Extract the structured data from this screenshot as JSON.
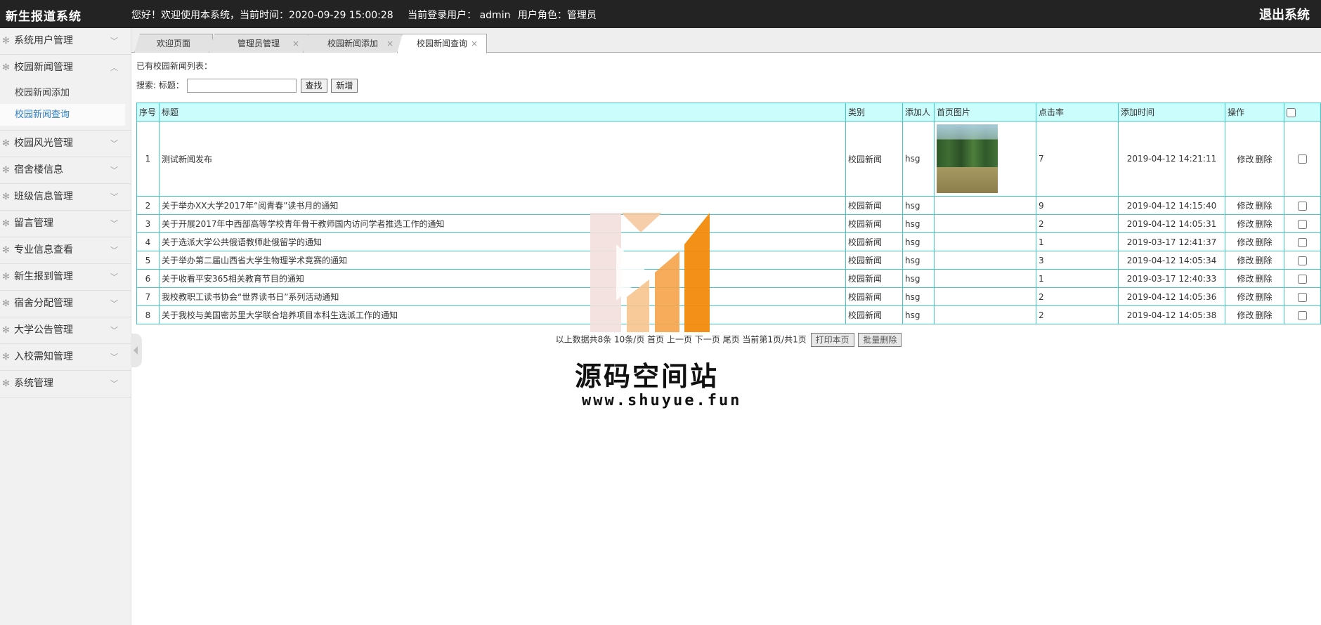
{
  "header": {
    "brand": "新生报道系统",
    "welcome": "您好！欢迎使用本系统，当前时间：2020-09-29 15:00:28",
    "current_user": "当前登录用户： admin",
    "user_role": "用户角色：管理员",
    "logout": "退出系统"
  },
  "sidebar": {
    "groups": [
      {
        "label": "系统用户管理"
      },
      {
        "label": "校园新闻管理",
        "expanded": true,
        "items": [
          {
            "label": "校园新闻添加"
          },
          {
            "label": "校园新闻查询",
            "active": true
          }
        ]
      },
      {
        "label": "校园风光管理"
      },
      {
        "label": "宿舍楼信息"
      },
      {
        "label": "班级信息管理"
      },
      {
        "label": "留言管理"
      },
      {
        "label": "专业信息查看"
      },
      {
        "label": "新生报到管理"
      },
      {
        "label": "宿舍分配管理"
      },
      {
        "label": "大学公告管理"
      },
      {
        "label": "入校需知管理"
      },
      {
        "label": "系统管理"
      }
    ]
  },
  "tabs": [
    {
      "label": "欢迎页面"
    },
    {
      "label": "管理员管理",
      "closable": true
    },
    {
      "label": "校园新闻添加",
      "closable": true
    },
    {
      "label": "校园新闻查询",
      "closable": true,
      "active": true
    }
  ],
  "content": {
    "list_title": "已有校园新闻列表：",
    "search_label": "搜索: 标题：",
    "search_value": "",
    "search_button": "查找",
    "add_button": "新增"
  },
  "table": {
    "headers": [
      "序号",
      "标题",
      "类别",
      "添加人",
      "首页图片",
      "点击率",
      "添加时间",
      "操作"
    ],
    "edit_label": "修改",
    "delete_label": "删除",
    "rows": [
      {
        "no": "1",
        "title": "测试新闻发布",
        "category": "校园新闻",
        "author": "hsg",
        "has_image": true,
        "clicks": "7",
        "time": "2019-04-12 14:21:11"
      },
      {
        "no": "2",
        "title": "关于举办XX大学2017年“阅青春”读书月的通知",
        "category": "校园新闻",
        "author": "hsg",
        "has_image": false,
        "clicks": "9",
        "time": "2019-04-12 14:15:40"
      },
      {
        "no": "3",
        "title": "关于开展2017年中西部高等学校青年骨干教师国内访问学者推选工作的通知",
        "category": "校园新闻",
        "author": "hsg",
        "has_image": false,
        "clicks": "2",
        "time": "2019-04-12 14:05:31"
      },
      {
        "no": "4",
        "title": "关于选派大学公共俄语教师赴俄留学的通知",
        "category": "校园新闻",
        "author": "hsg",
        "has_image": false,
        "clicks": "1",
        "time": "2019-03-17 12:41:37"
      },
      {
        "no": "5",
        "title": "关于举办第二届山西省大学生物理学术竞赛的通知",
        "category": "校园新闻",
        "author": "hsg",
        "has_image": false,
        "clicks": "3",
        "time": "2019-04-12 14:05:34"
      },
      {
        "no": "6",
        "title": "关于收看平安365相关教育节目的通知",
        "category": "校园新闻",
        "author": "hsg",
        "has_image": false,
        "clicks": "1",
        "time": "2019-03-17 12:40:33"
      },
      {
        "no": "7",
        "title": "我校教职工读书协会“世界读书日”系列活动通知",
        "category": "校园新闻",
        "author": "hsg",
        "has_image": false,
        "clicks": "2",
        "time": "2019-04-12 14:05:36"
      },
      {
        "no": "8",
        "title": "关于我校与美国密苏里大学联合培养项目本科生选派工作的通知",
        "category": "校园新闻",
        "author": "hsg",
        "has_image": false,
        "clicks": "2",
        "time": "2019-04-12 14:05:38"
      }
    ]
  },
  "pager": {
    "summary": "以上数据共8条 10条/页 首页 上一页 下一页 尾页 当前第1页/共1页",
    "print_button": "打印本页",
    "batch_delete_button": "批量删除"
  },
  "watermark": {
    "title": "源码空间站",
    "url": "www.shuyue.fun",
    "colors": {
      "light": "#f2dfdc",
      "orange": "#f5a348",
      "deep": "#f28a0c"
    }
  }
}
